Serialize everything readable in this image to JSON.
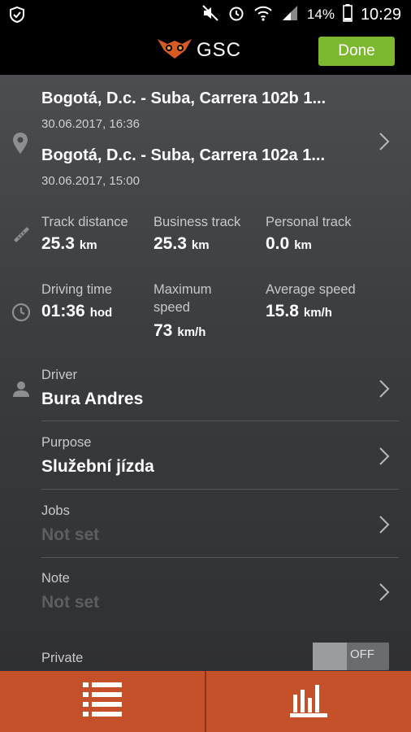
{
  "status_bar": {
    "battery": "14%",
    "time": "10:29"
  },
  "app_bar": {
    "logo_text": "GSC",
    "done_label": "Done"
  },
  "trip": {
    "start_address": "Bogotá, D.c. - Suba, Carrera 102b 1...",
    "start_time": "30.06.2017, 16:36",
    "end_address": "Bogotá, D.c. - Suba, Carrera 102a 1...",
    "end_time": "30.06.2017, 15:00"
  },
  "stats": {
    "track_distance": {
      "label": "Track distance",
      "value": "25.3",
      "unit": "km"
    },
    "business_track": {
      "label": "Business track",
      "value": "25.3",
      "unit": "km"
    },
    "personal_track": {
      "label": "Personal track",
      "value": "0.0",
      "unit": "km"
    },
    "driving_time": {
      "label": "Driving time",
      "value": "01:36",
      "unit": "hod"
    },
    "max_speed": {
      "label": "Maximum speed",
      "value": "73",
      "unit": "km/h"
    },
    "avg_speed": {
      "label": "Average speed",
      "value": "15.8",
      "unit": "km/h"
    }
  },
  "fields": {
    "driver": {
      "label": "Driver",
      "value": "Bura Andres"
    },
    "purpose": {
      "label": "Purpose",
      "value": "Služební jízda"
    },
    "jobs": {
      "label": "Jobs",
      "value": "Not set"
    },
    "note": {
      "label": "Note",
      "value": "Not set"
    },
    "private": {
      "label": "Private",
      "toggle": "OFF"
    }
  },
  "colors": {
    "accent": "#c4512a",
    "done": "#7cb82f"
  },
  "tabs": [
    {
      "icon": "list-icon"
    },
    {
      "icon": "bar-chart-icon"
    }
  ]
}
